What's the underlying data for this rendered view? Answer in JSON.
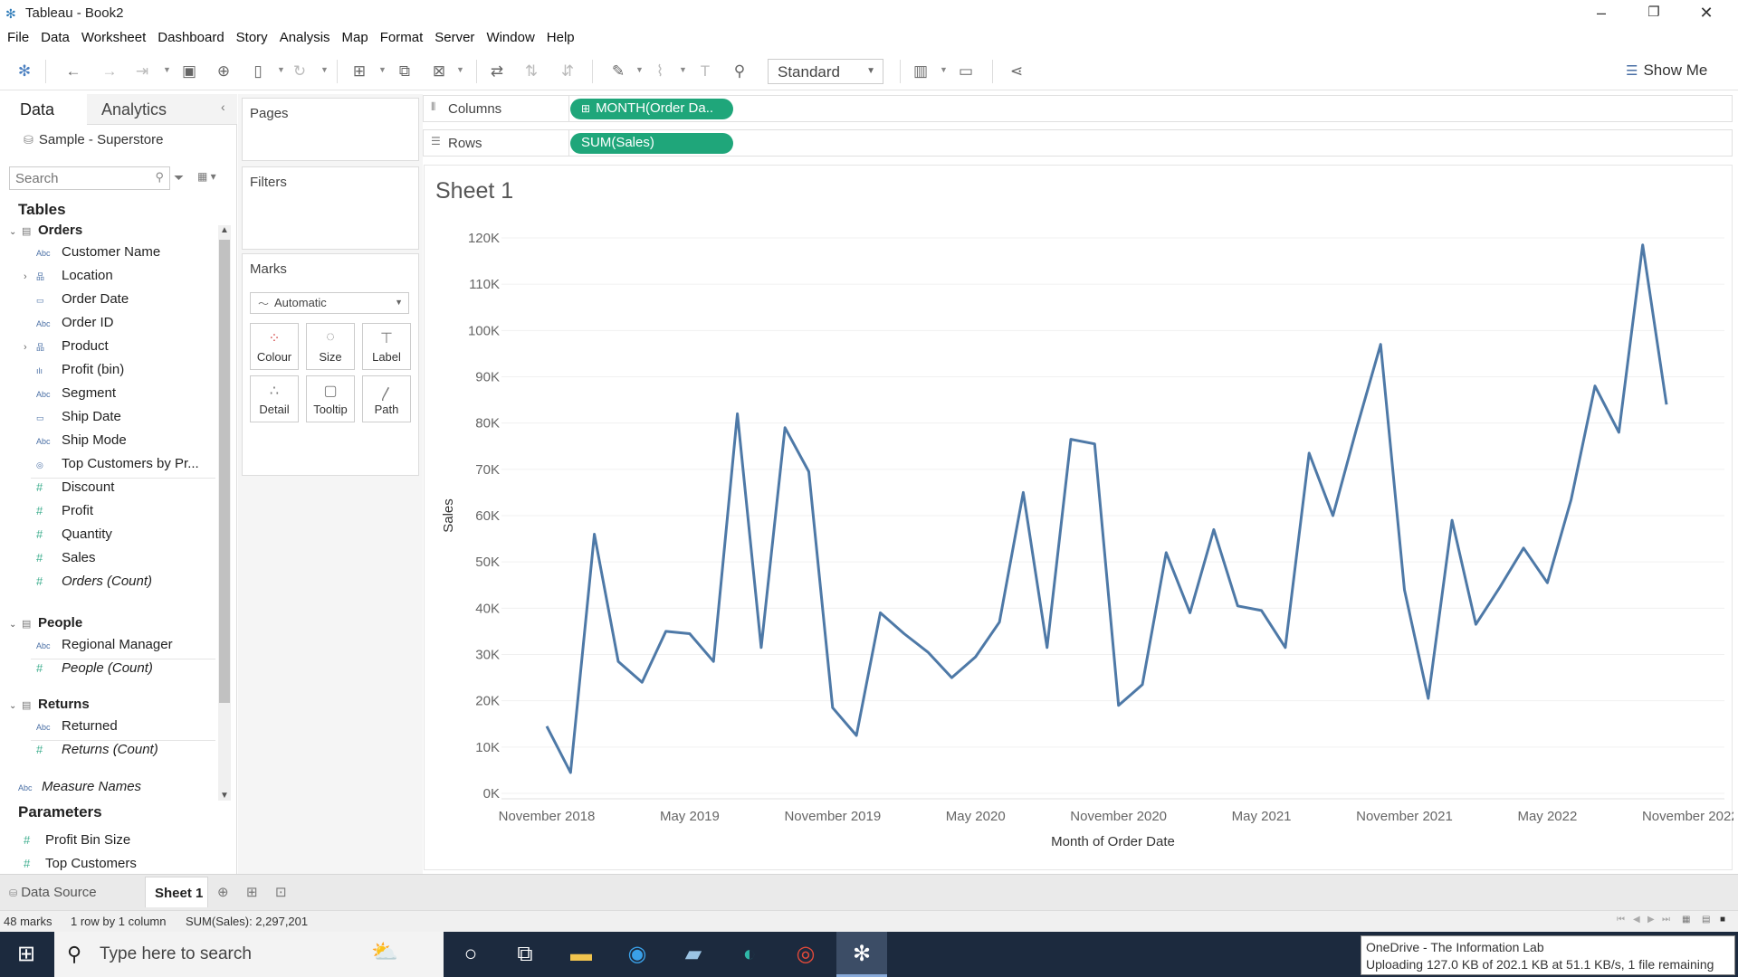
{
  "window": {
    "title": "Tableau - Book2",
    "minimize_glyph": "–",
    "restore_glyph": "❐",
    "close_glyph": "✕"
  },
  "menu": [
    "File",
    "Data",
    "Worksheet",
    "Dashboard",
    "Story",
    "Analysis",
    "Map",
    "Format",
    "Server",
    "Window",
    "Help"
  ],
  "toolbar": {
    "fit_value": "Standard",
    "show_me_label": "Show Me",
    "icons": [
      "tableau-logo-icon",
      "undo-icon",
      "redo-icon",
      "replay-icon",
      "save-icon",
      "new-datasource-icon",
      "pause-icon",
      "refresh-icon",
      "new-worksheet-icon",
      "duplicate-icon",
      "clear-icon",
      "swap-icon",
      "sort-asc-icon",
      "sort-desc-icon",
      "highlight-icon",
      "group-icon",
      "labels-icon",
      "pin-icon",
      "show-cards-icon",
      "presentation-icon",
      "share-icon"
    ]
  },
  "data_pane": {
    "tab_data": "Data",
    "tab_analytics": "Analytics",
    "collapse_glyph": "‹",
    "datasource": "Sample - Superstore",
    "search_placeholder": "Search",
    "tables_header": "Tables",
    "parameters_header": "Parameters",
    "tables": {
      "orders": {
        "name": "Orders",
        "fields": [
          {
            "name": "Customer Name",
            "type": "Abc",
            "kind": "dim"
          },
          {
            "name": "Location",
            "type": "hier",
            "kind": "dim",
            "expandable": true
          },
          {
            "name": "Order Date",
            "type": "date",
            "kind": "dim"
          },
          {
            "name": "Order ID",
            "type": "Abc",
            "kind": "dim"
          },
          {
            "name": "Product",
            "type": "hier",
            "kind": "dim",
            "expandable": true
          },
          {
            "name": "Profit (bin)",
            "type": "bin",
            "kind": "dim"
          },
          {
            "name": "Segment",
            "type": "Abc",
            "kind": "dim"
          },
          {
            "name": "Ship Date",
            "type": "date",
            "kind": "dim"
          },
          {
            "name": "Ship Mode",
            "type": "Abc",
            "kind": "dim"
          },
          {
            "name": "Top Customers by Pr...",
            "type": "set",
            "kind": "dim"
          },
          {
            "name": "Discount",
            "type": "#",
            "kind": "meas"
          },
          {
            "name": "Profit",
            "type": "#",
            "kind": "meas"
          },
          {
            "name": "Quantity",
            "type": "#",
            "kind": "meas"
          },
          {
            "name": "Sales",
            "type": "#",
            "kind": "meas"
          },
          {
            "name": "Orders (Count)",
            "type": "#",
            "kind": "meas",
            "italic": true
          }
        ]
      },
      "people": {
        "name": "People",
        "fields": [
          {
            "name": "Regional Manager",
            "type": "Abc",
            "kind": "dim"
          },
          {
            "name": "People (Count)",
            "type": "#",
            "kind": "meas",
            "italic": true
          }
        ]
      },
      "returns": {
        "name": "Returns",
        "fields": [
          {
            "name": "Returned",
            "type": "Abc",
            "kind": "dim"
          },
          {
            "name": "Returns (Count)",
            "type": "#",
            "kind": "meas",
            "italic": true
          }
        ]
      }
    },
    "measure_names": "Measure Names",
    "parameters": [
      "Profit Bin Size",
      "Top Customers"
    ]
  },
  "cards": {
    "pages": "Pages",
    "filters": "Filters",
    "marks": "Marks",
    "mark_type": "Automatic",
    "buttons": {
      "colour": "Colour",
      "size": "Size",
      "label": "Label",
      "detail": "Detail",
      "tooltip": "Tooltip",
      "path": "Path"
    }
  },
  "shelves": {
    "columns_label": "Columns",
    "columns_pill": "MONTH(Order Da..",
    "rows_label": "Rows",
    "rows_pill": "SUM(Sales)"
  },
  "sheet": {
    "title": "Sheet 1"
  },
  "chart_data": {
    "type": "line",
    "xlabel": "Month of Order Date",
    "ylabel": "Sales",
    "ylim": [
      0,
      120000
    ],
    "y_ticks": [
      0,
      10000,
      20000,
      30000,
      40000,
      50000,
      60000,
      70000,
      80000,
      90000,
      100000,
      110000,
      120000
    ],
    "y_tick_labels": [
      "0K",
      "10K",
      "20K",
      "30K",
      "40K",
      "50K",
      "60K",
      "70K",
      "80K",
      "90K",
      "100K",
      "110K",
      "120K"
    ],
    "x_tick_labels": [
      "November 2018",
      "May 2019",
      "November 2019",
      "May 2020",
      "November 2020",
      "May 2021",
      "November 2021",
      "May 2022",
      "November 2022"
    ],
    "x_start": "2018-11",
    "x_end": "2022-12",
    "series": [
      {
        "color": "#4e79a7",
        "values": [
          14500,
          4500,
          56000,
          28500,
          24000,
          35000,
          34500,
          28500,
          82000,
          31500,
          79000,
          69500,
          18500,
          12500,
          39000,
          34500,
          30500,
          25000,
          29500,
          37000,
          65000,
          31500,
          76500,
          75500,
          19000,
          23500,
          52000,
          39000,
          57000,
          40500,
          39500,
          31500,
          73500,
          60000,
          79000,
          97000,
          44000,
          20500,
          59000,
          36500,
          44500,
          53000,
          45500,
          63500,
          88000,
          78000,
          118500,
          84000
        ]
      }
    ],
    "grid": "horizontal",
    "legend": "none"
  },
  "sheet_tabs": {
    "datasource": "Data Source",
    "sheet1": "Sheet 1"
  },
  "status": {
    "marks": "48 marks",
    "dims": "1 row by 1 column",
    "sum": "SUM(Sales): 2,297,201"
  },
  "taskbar": {
    "search_placeholder": "Type here to search"
  },
  "toast": {
    "title": "OneDrive - The Information Lab",
    "message": "Uploading 127.0 KB of 202.1 KB at 51.1 KB/s, 1 file remaining"
  }
}
